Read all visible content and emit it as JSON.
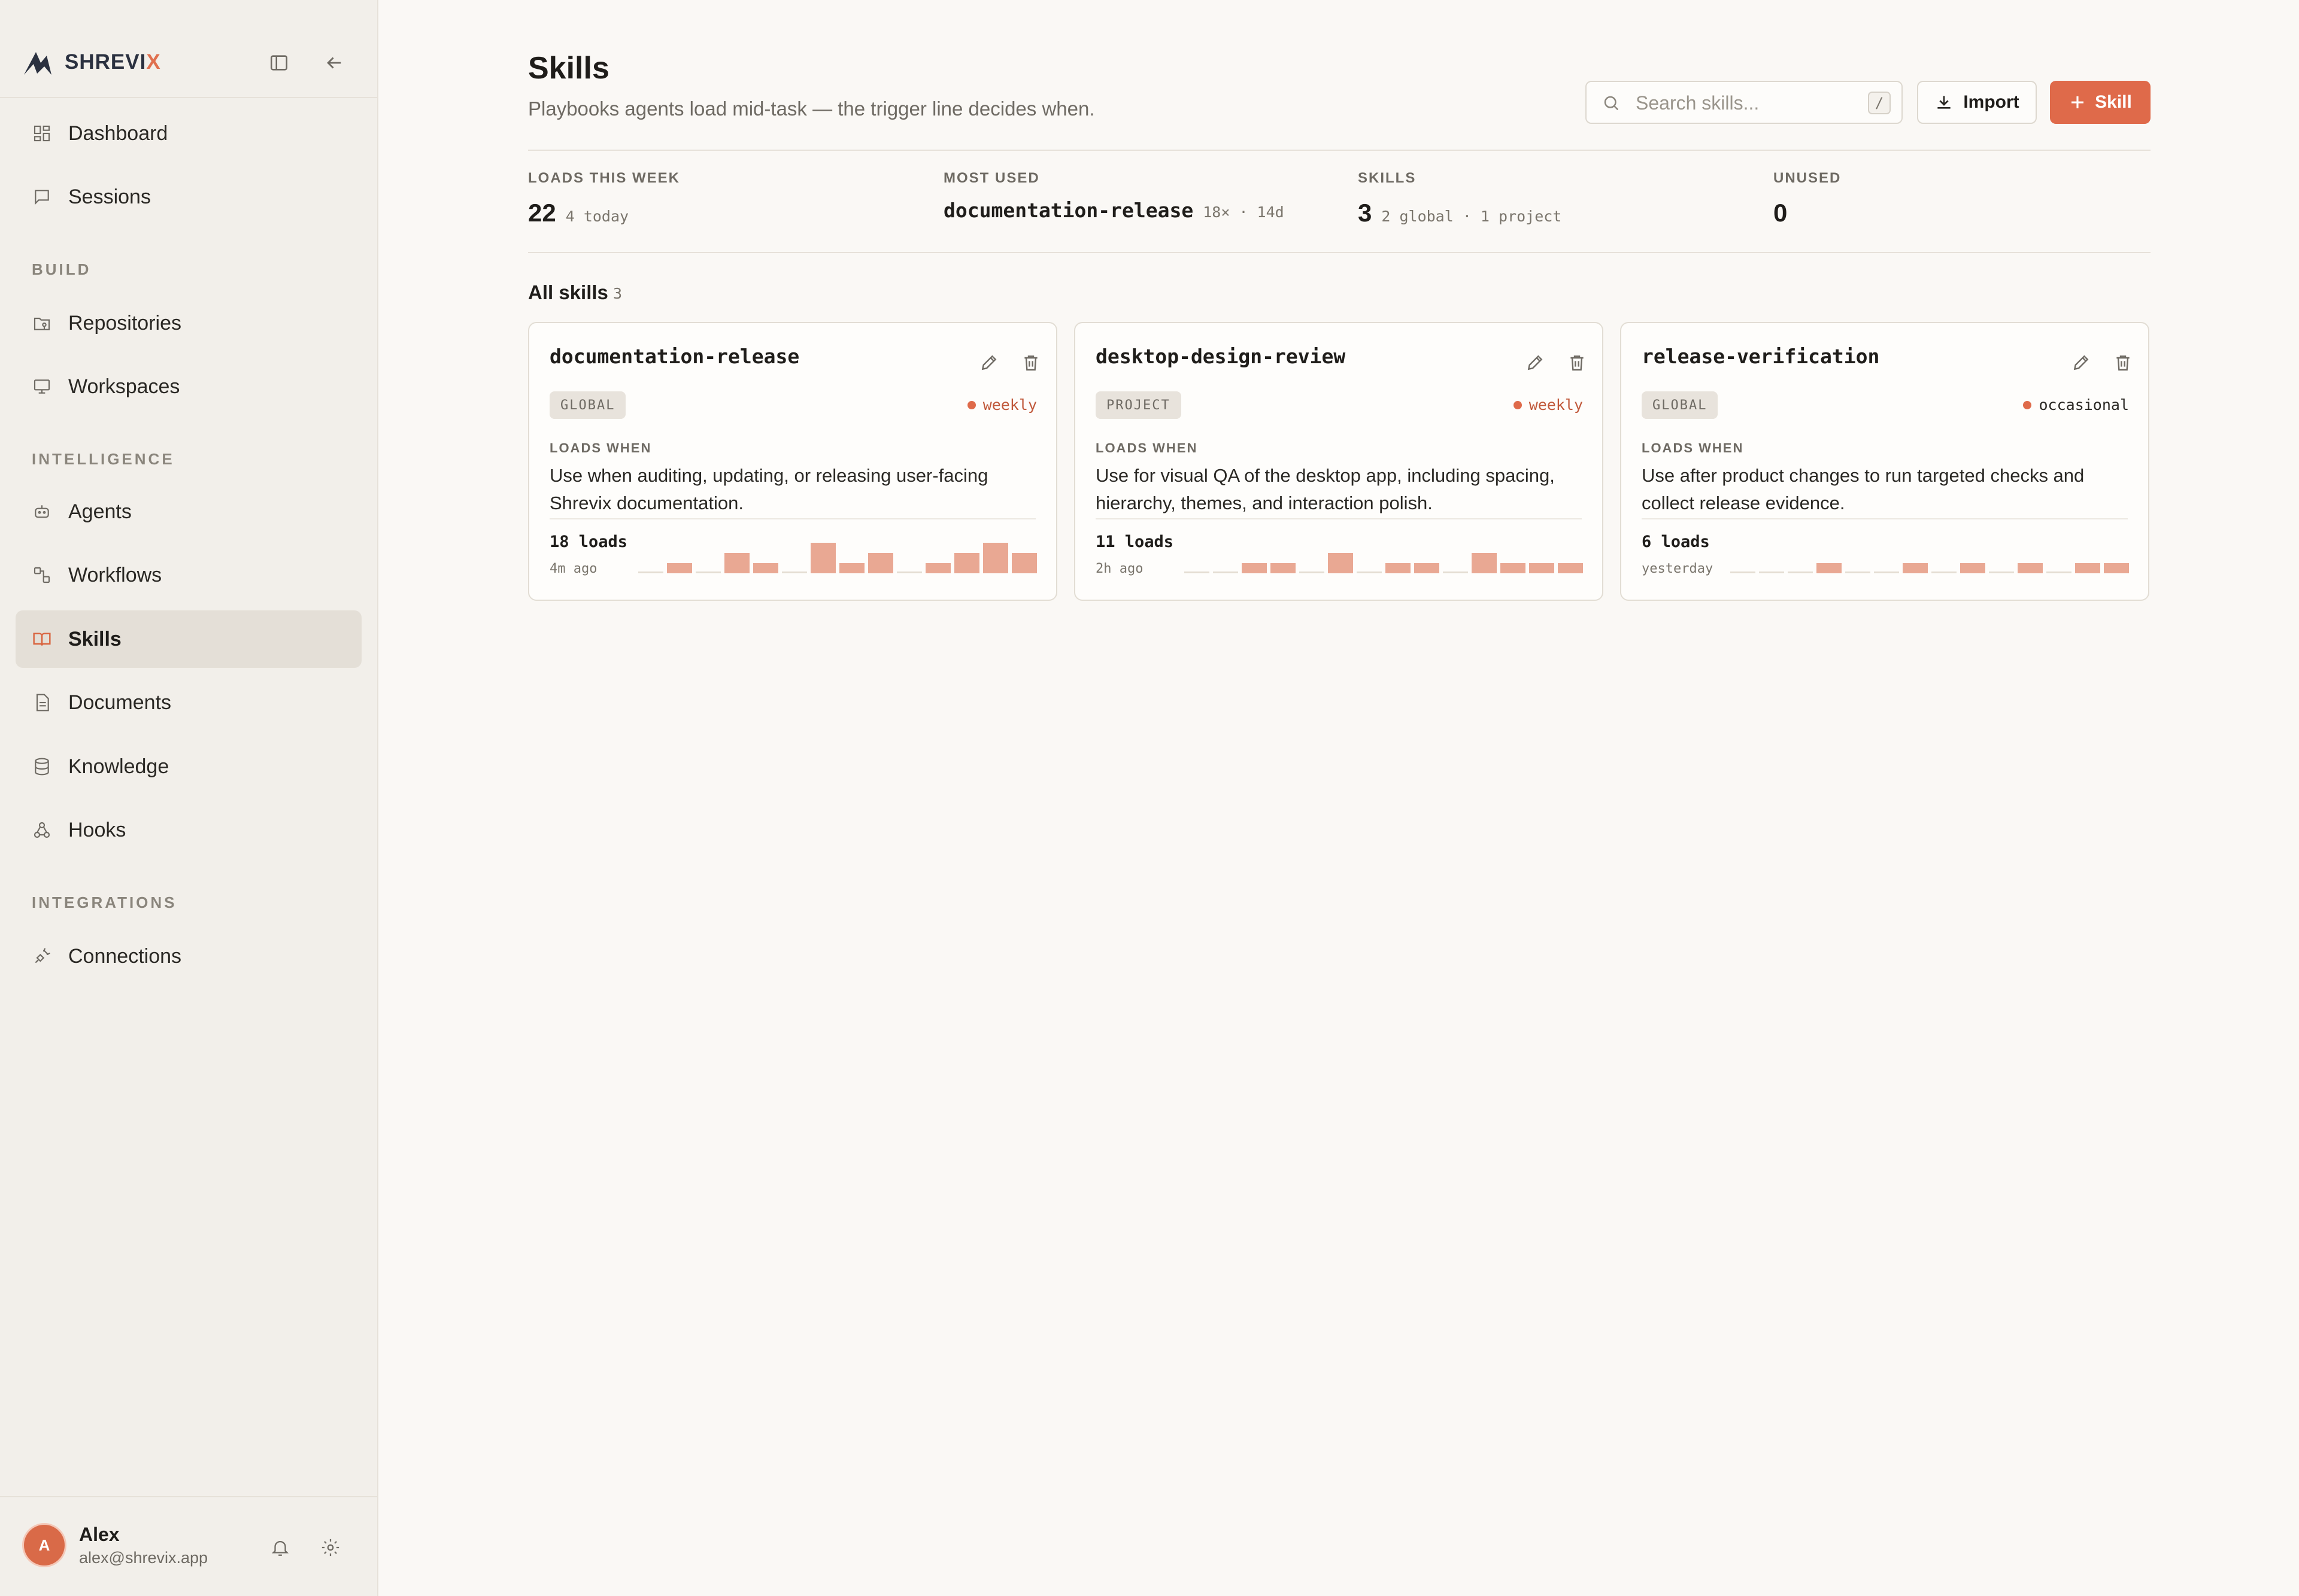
{
  "brand": {
    "name_main": "SHREVI",
    "name_accent": "X"
  },
  "sidebar": {
    "items": [
      {
        "label": "Dashboard",
        "icon": "dashboard-icon"
      },
      {
        "label": "Sessions",
        "icon": "chat-icon"
      },
      {
        "label": "Repositories",
        "icon": "folder-git-icon"
      },
      {
        "label": "Workspaces",
        "icon": "monitor-icon"
      },
      {
        "label": "Agents",
        "icon": "bot-icon"
      },
      {
        "label": "Workflows",
        "icon": "workflow-icon"
      },
      {
        "label": "Skills",
        "icon": "book-icon",
        "active": true
      },
      {
        "label": "Documents",
        "icon": "document-icon"
      },
      {
        "label": "Knowledge",
        "icon": "database-icon"
      },
      {
        "label": "Hooks",
        "icon": "webhook-icon"
      },
      {
        "label": "Connections",
        "icon": "plug-icon"
      }
    ],
    "sections": {
      "build": "BUILD",
      "intelligence": "INTELLIGENCE",
      "integrations": "INTEGRATIONS"
    }
  },
  "user": {
    "initial": "A",
    "name": "Alex",
    "email": "alex@shrevix.app"
  },
  "header": {
    "title": "Skills",
    "subtitle": "Playbooks agents load mid-task — the trigger line decides when.",
    "search_placeholder": "Search skills...",
    "search_shortcut": "/",
    "import_label": "Import",
    "add_label": "Skill"
  },
  "stats": {
    "loads_week": {
      "label": "LOADS THIS WEEK",
      "value": "22",
      "sub": "4 today"
    },
    "most_used": {
      "label": "MOST USED",
      "value": "documentation-release",
      "sub": "18× · 14d"
    },
    "skills": {
      "label": "SKILLS",
      "value": "3",
      "sub": "2 global · 1 project"
    },
    "unused": {
      "label": "UNUSED",
      "value": "0"
    }
  },
  "list": {
    "title": "All skills",
    "count": "3"
  },
  "cards": [
    {
      "name": "documentation-release",
      "scope": "GLOBAL",
      "frequency": "weekly",
      "frequency_color": "#c0583a",
      "loads_when_label": "LOADS WHEN",
      "description": "Use when auditing, updating, or releasing user-facing Shrevix documentation.",
      "loads": "18 loads",
      "ago": "4m ago",
      "spark": [
        0,
        1,
        0,
        2,
        1,
        0,
        3,
        1,
        2,
        0,
        1,
        2,
        3,
        2
      ]
    },
    {
      "name": "desktop-design-review",
      "scope": "PROJECT",
      "frequency": "weekly",
      "frequency_color": "#c0583a",
      "loads_when_label": "LOADS WHEN",
      "description": "Use for visual QA of the desktop app, including spacing, hierarchy, themes, and interaction polish.",
      "loads": "11 loads",
      "ago": "2h ago",
      "spark": [
        0,
        0,
        1,
        1,
        0,
        2,
        0,
        1,
        1,
        0,
        2,
        1,
        1,
        1
      ]
    },
    {
      "name": "release-verification",
      "scope": "GLOBAL",
      "frequency": "occasional",
      "frequency_color": "#2a2824",
      "loads_when_label": "LOADS WHEN",
      "description": "Use after product changes to run targeted checks and collect release evidence.",
      "loads": "6 loads",
      "ago": "yesterday",
      "spark": [
        0,
        0,
        0,
        1,
        0,
        0,
        1,
        0,
        1,
        0,
        1,
        0,
        1,
        1
      ]
    }
  ]
}
